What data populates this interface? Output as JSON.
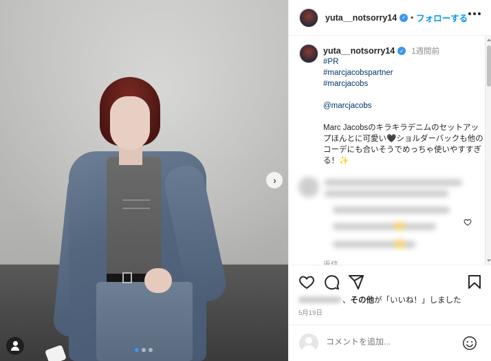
{
  "post": {
    "username": "yuta__notsorry14",
    "separator": "•",
    "follow_label": "フォローする",
    "time_ago": "1週間前",
    "caption": {
      "tags": [
        "#PR",
        "#marcjacobspartner",
        "#marcjacobs"
      ],
      "mention": "@marcjacobs",
      "text": "Marc Jacobsのキラキラデニムのセットアップほんとに可愛い🖤ショルダーバックも他のコーデにも合いそうでめっちゃ使いやすすぎる！✨"
    },
    "reply_stub": "返信",
    "likes": {
      "comma": "、",
      "others_label": "その他",
      "suffix": "が「いいね！」しました"
    },
    "date": "5月19日",
    "comment_placeholder": "コメントを追加..."
  },
  "carousel": {
    "slide_count": 3,
    "active_index": 0
  },
  "colors": {
    "accent_blue": "#0095f6",
    "verified_blue": "#3897f0",
    "hashtag": "#00376b",
    "muted": "#8e8e8e"
  },
  "icons": [
    "chevron-right-icon",
    "user-tag-icon",
    "verified-icon",
    "more-icon",
    "heart-icon",
    "comment-icon",
    "share-icon",
    "bookmark-icon",
    "emoji-icon"
  ]
}
